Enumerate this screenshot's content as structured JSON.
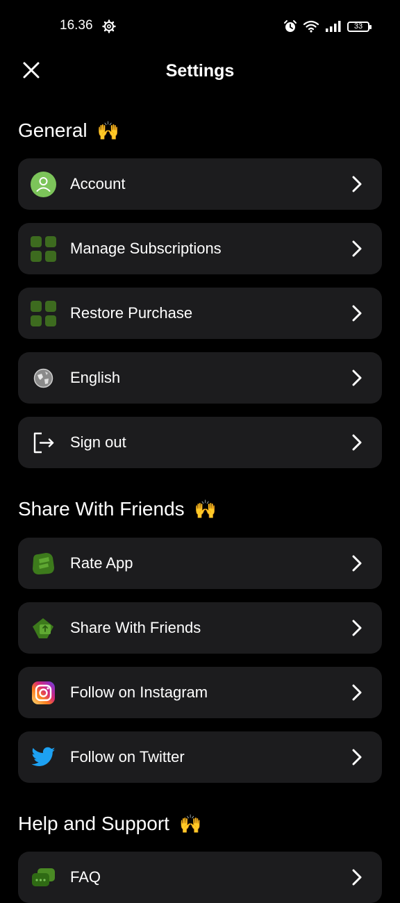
{
  "status_bar": {
    "time": "16.36",
    "battery": "33"
  },
  "header": {
    "title": "Settings"
  },
  "sections": [
    {
      "title": "General",
      "emoji": "🙌",
      "items": [
        {
          "label": "Account",
          "icon": "user-icon"
        },
        {
          "label": "Manage Subscriptions",
          "icon": "grid-icon"
        },
        {
          "label": "Restore Purchase",
          "icon": "grid-icon"
        },
        {
          "label": "English",
          "icon": "globe-icon"
        },
        {
          "label": "Sign out",
          "icon": "sign-out-icon"
        }
      ]
    },
    {
      "title": "Share With Friends",
      "emoji": "🙌",
      "items": [
        {
          "label": "Rate App",
          "icon": "rate-icon"
        },
        {
          "label": "Share With Friends",
          "icon": "share-icon"
        },
        {
          "label": "Follow on Instagram",
          "icon": "instagram-icon"
        },
        {
          "label": "Follow on Twitter",
          "icon": "twitter-icon"
        }
      ]
    },
    {
      "title": "Help and Support",
      "emoji": "🙌",
      "items": [
        {
          "label": "FAQ",
          "icon": "chat-icon"
        }
      ]
    }
  ],
  "colors": {
    "background": "#000000",
    "row_background": "#1c1c1e",
    "accent_green": "#3d6b1f",
    "account_green": "#7cc45a",
    "twitter_blue": "#1da1f2"
  }
}
